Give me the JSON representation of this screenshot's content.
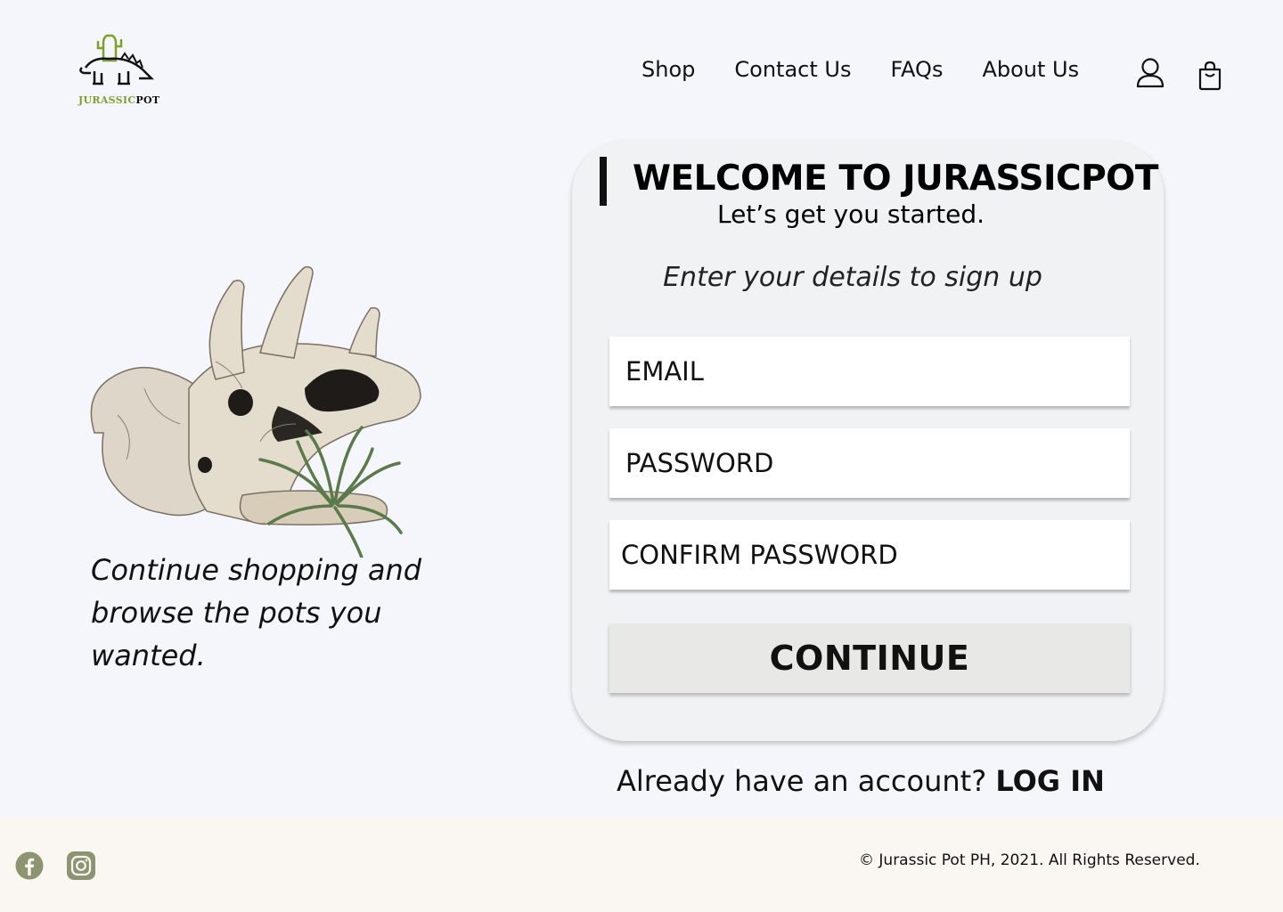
{
  "brand": {
    "logo_text_green": "JURASSIC",
    "logo_text_dark": "POT",
    "accent_green": "#7ea12b"
  },
  "nav": {
    "items": [
      {
        "label": "Shop"
      },
      {
        "label": "Contact Us"
      },
      {
        "label": "FAQs"
      },
      {
        "label": "About Us"
      }
    ],
    "icons": [
      "user-icon",
      "shopping-bag-icon"
    ]
  },
  "promo": {
    "image": "triceratops-skull-planter",
    "text": "Continue shopping and browse the pots you wanted."
  },
  "signup": {
    "title": "WELCOME TO JURASSICPOT",
    "subtitle": "Let’s get you started.",
    "hint": "Enter your details to sign up",
    "email_placeholder": "EMAIL",
    "password_placeholder": "PASSWORD",
    "confirm_placeholder": "CONFIRM PASSWORD",
    "continue_label": "CONTINUE"
  },
  "login_prompt": {
    "text": "Already have an account?",
    "link": "LOG IN"
  },
  "footer": {
    "social": [
      "facebook-icon",
      "instagram-icon"
    ],
    "copyright": "© Jurassic Pot PH, 2021. All Rights Reserved.",
    "social_color": "#8d9472"
  }
}
